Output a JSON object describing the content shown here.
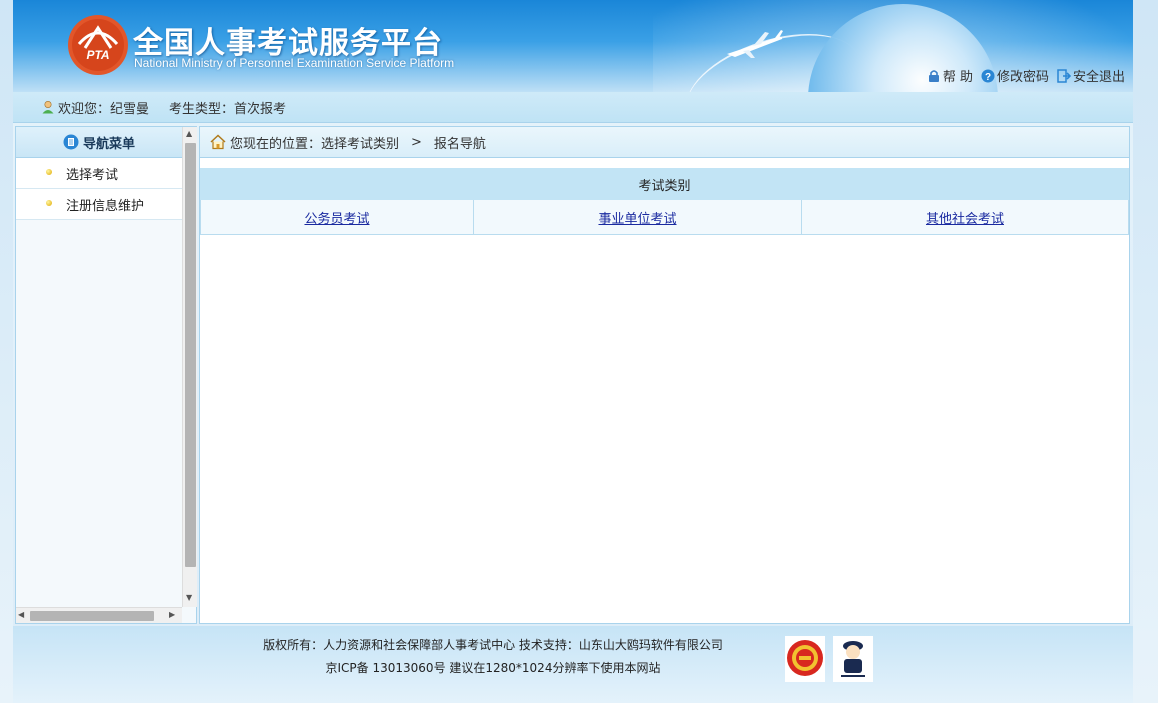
{
  "header": {
    "title": "全国人事考试服务平台",
    "subtitle": "National Ministry of Personnel Examination Service Platform",
    "logo_text": "PTA",
    "links": [
      {
        "label": "帮 助",
        "icon": "lock-icon"
      },
      {
        "label": "修改密码",
        "icon": "help-icon"
      },
      {
        "label": "安全退出",
        "icon": "logout-icon"
      }
    ]
  },
  "infobar": {
    "welcome": "欢迎您：纪雪曼",
    "candidate_type": "考生类型：首次报考"
  },
  "sidebar": {
    "title": "导航菜单",
    "items": [
      {
        "label": "选择考试"
      },
      {
        "label": "注册信息维护"
      }
    ]
  },
  "breadcrumb": {
    "prefix": "您现在的位置：选择考试类别",
    "separator": ">",
    "current": "报名导航"
  },
  "exam_table": {
    "header": "考试类别",
    "links": [
      "公务员考试",
      "事业单位考试",
      "其他社会考试"
    ]
  },
  "footer": {
    "line1": "版权所有：人力资源和社会保障部人事考试中心  技术支持：山东山大鸥玛软件有限公司",
    "line2": "京ICP备 13013060号  建议在1280*1024分辨率下使用本网站"
  },
  "colors": {
    "header_blue": "#1a86d8",
    "link_blue": "#1a2aa0",
    "table_header_bg": "#c2e4f5"
  }
}
